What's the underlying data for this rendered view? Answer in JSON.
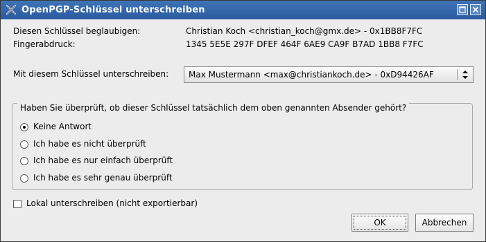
{
  "window": {
    "title": "OpenPGP-Schlüssel unterschreiben"
  },
  "info": {
    "certify_label": "Diesen Schlüssel beglaubigen:",
    "certify_value": "Christian Koch <christian_koch@gmx.de> - 0x1BB8F7FC",
    "fingerprint_label": "Fingerabdruck:",
    "fingerprint_value": "1345 5E5E 297F DFEF 464F 6AE9 CA9F B7AD 1BB8 F7FC"
  },
  "signing": {
    "label": "Mit diesem Schlüssel unterschreiben:",
    "selected": "Max Mustermann <max@christiankoch.de> - 0xD94426AF"
  },
  "verification": {
    "question": "Haben Sie überprüft, ob dieser Schlüssel tatsächlich dem oben genannten Absender gehört?",
    "options": [
      {
        "label": "Keine Antwort",
        "selected": true
      },
      {
        "label": "Ich habe es nicht überprüft",
        "selected": false
      },
      {
        "label": "Ich habe es nur einfach überprüft",
        "selected": false
      },
      {
        "label": "Ich habe es sehr genau überprüft",
        "selected": false
      }
    ]
  },
  "local_sign": {
    "label": "Lokal unterschreiben (nicht exportierbar)",
    "checked": false
  },
  "buttons": {
    "ok": "OK",
    "cancel": "Abbrechen"
  }
}
